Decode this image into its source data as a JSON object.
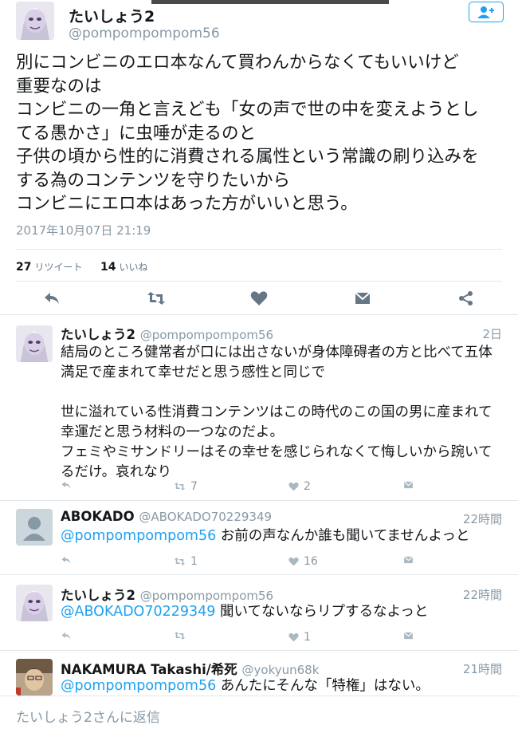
{
  "colors": {
    "accent": "#1da1f2",
    "text": "#14171a",
    "muted": "#8899a6",
    "divider": "#e1e8ed"
  },
  "main": {
    "name": "たいしょう2",
    "handle": "@pompompompom56",
    "follow_icon": "follow-user-icon",
    "lines": [
      "別にコンビニのエロ本なんて買わんからなくてもいいけど",
      "重要なのは",
      "コンビニの一角と言えども「女の声で世の中を変えようとし",
      "てる愚かさ」に虫唾が走るのと",
      "子供の頃から性的に消費される属性という常識の刷り込みを",
      "する為のコンテンツを守りたいから",
      "コンビニにエロ本はあった方がいいと思う。"
    ],
    "timestamp": "2017年10月07日 21:19",
    "retweets": "27",
    "retweets_label": "リツイート",
    "likes": "14",
    "likes_label": "いいね"
  },
  "replies": [
    {
      "name": "たいしょう2",
      "handle": "@pompompompom56",
      "time": "2日",
      "mention": "",
      "lines": [
        "結局のところ健常者が口には出さないが身体障碍者の方と比べて五体",
        "満足で産まれて幸せだと思う感性と同じで",
        "",
        "世に溢れている性消費コンテンツはこの時代のこの国の男に産まれて",
        "幸運だと思う材料の一つなのだよ。",
        "フェミやミサンドリーはその幸せを感じられなくて悔しいから踠いて",
        "るだけ。哀れなり"
      ],
      "retweets": "7",
      "likes": "2"
    },
    {
      "name": "ABOKADO",
      "handle": "@ABOKADO70229349",
      "time": "22時間",
      "mention": "@pompompompom56",
      "text": " お前の声なんか誰も聞いてませんよっと",
      "retweets": "1",
      "likes": "16"
    },
    {
      "name": "たいしょう2",
      "handle": "@pompompompom56",
      "time": "22時間",
      "mention": "@ABOKADO70229349",
      "text": " 聞いてないならリプするなよっと",
      "retweets": "",
      "likes": "1"
    },
    {
      "name": "NAKAMURA Takashi/希死",
      "handle": "@yokyun68k",
      "time": "21時間",
      "mention": "@pompompompom56",
      "text": " あんたにそんな「特権」はない。"
    }
  ],
  "compose": {
    "placeholder": "たいしょう2さんに返信"
  }
}
